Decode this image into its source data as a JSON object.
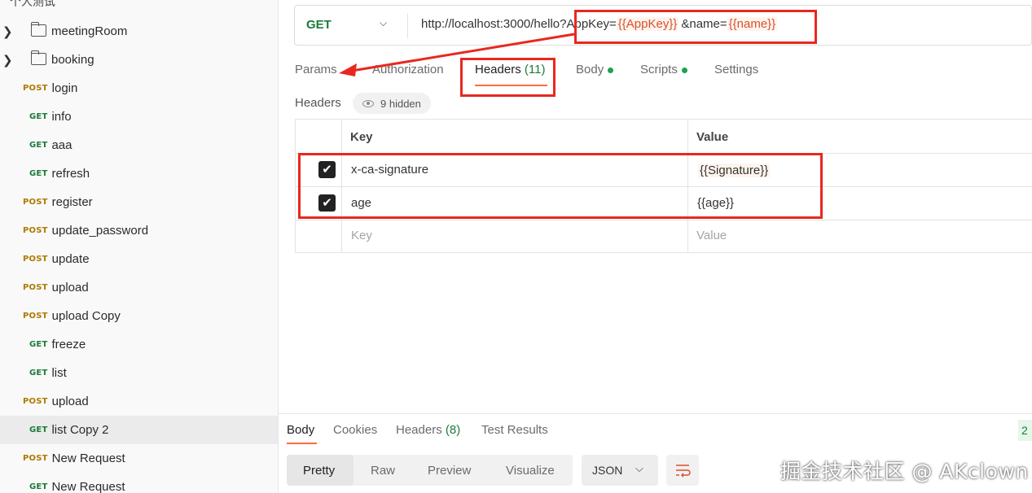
{
  "sidebar": {
    "top_label": "个人测试",
    "items": [
      {
        "type": "folder",
        "name": "meetingRoom"
      },
      {
        "type": "folder",
        "name": "booking"
      },
      {
        "type": "request",
        "method": "POST",
        "name": "login"
      },
      {
        "type": "request",
        "method": "GET",
        "name": "info"
      },
      {
        "type": "request",
        "method": "GET",
        "name": "aaa"
      },
      {
        "type": "request",
        "method": "GET",
        "name": "refresh"
      },
      {
        "type": "request",
        "method": "POST",
        "name": "register"
      },
      {
        "type": "request",
        "method": "POST",
        "name": "update_password"
      },
      {
        "type": "request",
        "method": "POST",
        "name": "update"
      },
      {
        "type": "request",
        "method": "POST",
        "name": "upload"
      },
      {
        "type": "request",
        "method": "POST",
        "name": "upload Copy"
      },
      {
        "type": "request",
        "method": "GET",
        "name": "freeze"
      },
      {
        "type": "request",
        "method": "GET",
        "name": "list"
      },
      {
        "type": "request",
        "method": "POST",
        "name": "upload"
      },
      {
        "type": "request",
        "method": "GET",
        "name": "list Copy 2",
        "active": true
      },
      {
        "type": "request",
        "method": "POST",
        "name": "New Request"
      },
      {
        "type": "request",
        "method": "GET",
        "name": "New Request"
      }
    ]
  },
  "request": {
    "method": "GET",
    "url_base": "http://localhost:3000/hello",
    "url_q1": "?AppKey=",
    "url_v1": "{{AppKey}}",
    "url_q2": "&name=",
    "url_v2": "{{name}}"
  },
  "tabs": {
    "params": "Params",
    "authorization": "Authorization",
    "headers": "Headers",
    "headers_count": "(11)",
    "body": "Body",
    "scripts": "Scripts",
    "settings": "Settings"
  },
  "headers_section": {
    "title": "Headers",
    "hidden": "9 hidden",
    "col_key": "Key",
    "col_value": "Value",
    "rows": [
      {
        "key": "x-ca-signature",
        "value": "{{Signature}}",
        "checked": true
      },
      {
        "key": "age",
        "value": "{{age}}",
        "checked": true
      }
    ],
    "placeholder_key": "Key",
    "placeholder_value": "Value"
  },
  "response": {
    "tabs": {
      "body": "Body",
      "cookies": "Cookies",
      "headers": "Headers",
      "headers_count": "(8)",
      "test_results": "Test Results"
    },
    "view_modes": [
      "Pretty",
      "Raw",
      "Preview",
      "Visualize"
    ],
    "format": "JSON",
    "status_badge": "2"
  },
  "watermark": "掘金技术社区 @ AKclown",
  "colors": {
    "accent": "#ff6c37",
    "get": "#1b7a3a",
    "post": "#ad7a00",
    "annotation": "#e8281f",
    "variable": "#d9502e"
  }
}
